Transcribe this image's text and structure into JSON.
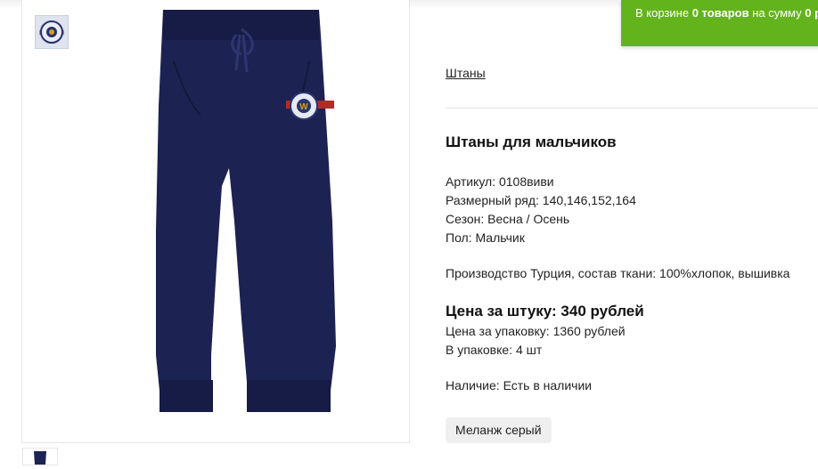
{
  "cart": {
    "prefix": "В корзине",
    "count": "0 товаров",
    "middle": "на сумму",
    "total": "0 р"
  },
  "breadcrumb": "Штаны",
  "product": {
    "title": "Штаны для мальчиков",
    "properties": [
      "Артикул: 0108виви",
      "Размерный ряд: 140,146,152,164",
      "Сезон: Весна / Осень",
      "Пол: Мальчик"
    ],
    "description": "Производство Турция, состав ткани: 100%хлопок, вышивка",
    "price_label": "Цена за штуку: 340 рублей",
    "pack_price": "Цена за упаковку: 1360 рублей",
    "pack_count": "В упаковке: 4 шт",
    "availability": "Наличие: Есть в наличии",
    "variant": "Меланж серый"
  },
  "images": {
    "main": "navy-pants-photo",
    "badge_thumb": "logo-badge-thumbnail",
    "small_thumb": "pants-thumbnail",
    "badge_letter": "W"
  },
  "colors": {
    "pants": "#1c2352",
    "cart_bg": "#63b31c"
  }
}
